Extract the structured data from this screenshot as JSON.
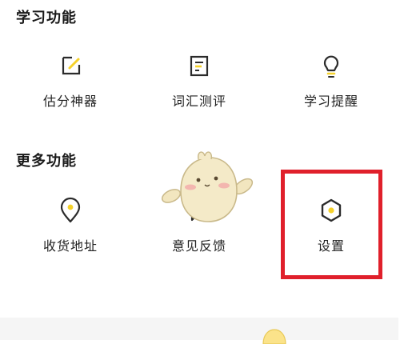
{
  "sections": {
    "study": {
      "title": "学习功能",
      "items": [
        {
          "label": "估分神器",
          "icon": "edit-icon"
        },
        {
          "label": "词汇测评",
          "icon": "vocab-test-icon"
        },
        {
          "label": "学习提醒",
          "icon": "lightbulb-icon"
        }
      ]
    },
    "more": {
      "title": "更多功能",
      "items": [
        {
          "label": "收货地址",
          "icon": "location-pin-icon"
        },
        {
          "label": "意见反馈",
          "icon": "feedback-icon"
        },
        {
          "label": "设置",
          "icon": "settings-hexagon-icon"
        }
      ]
    }
  },
  "colors": {
    "accent_yellow": "#f5d12a",
    "icon_dark": "#2b2b2b",
    "highlight_red": "#e0202b",
    "footer_bg": "#f5f5f5"
  }
}
